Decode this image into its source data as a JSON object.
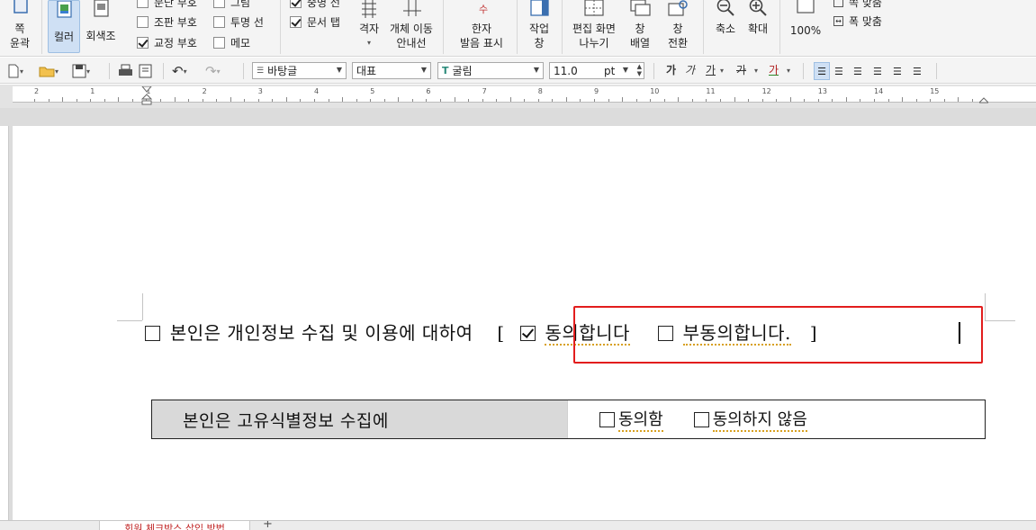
{
  "ribbon": {
    "outline_button": {
      "line1": "쪽",
      "line2": "윤곽"
    },
    "color_button": "컬러",
    "grayscale_button": "회색조",
    "checks_col1": [
      {
        "label": "문단 부호",
        "checked": false
      },
      {
        "label": "조판 부호",
        "checked": false
      },
      {
        "label": "교정 부호",
        "checked": true
      }
    ],
    "checks_col2": [
      {
        "label": "그림",
        "checked": false
      },
      {
        "label": "투명 선",
        "checked": false
      },
      {
        "label": "메모",
        "checked": false
      }
    ],
    "checks_col3": [
      {
        "label": "중명 선",
        "checked": true
      },
      {
        "label": "문서 탭",
        "checked": true
      }
    ],
    "grid_button": "격자",
    "object_guide_button": {
      "line1": "개체 이동",
      "line2": "안내선"
    },
    "hanja_button": {
      "icon_char": "수",
      "line1": "한자",
      "line2": "발음 표시"
    },
    "task_pane_button": {
      "line1": "작업",
      "line2": "창"
    },
    "split_view_button": {
      "line1": "편집 화면",
      "line2": "나누기"
    },
    "arrange_button": {
      "line1": "창",
      "line2": "배열"
    },
    "switch_button": {
      "line1": "창",
      "line2": "전환"
    },
    "zoom_out_button": "축소",
    "zoom_in_button": "확대",
    "zoom_level": "100%",
    "fit_page_label": "쪽 맞춤",
    "fit_width_label": "폭 맞춤"
  },
  "toolbar": {
    "style_value": "바탕글",
    "lang_value": "대표",
    "font_value": "굴림",
    "size_value": "11.0",
    "size_unit": "pt",
    "bold": "가",
    "italic": "가",
    "underline": "가",
    "strike": "가",
    "fontcolor": "가"
  },
  "ruler": {
    "labels": [
      "2",
      "1",
      "1",
      "2",
      "3",
      "4",
      "5",
      "6",
      "7",
      "8",
      "9",
      "10",
      "11",
      "12",
      "13",
      "14",
      "15"
    ]
  },
  "document": {
    "consent_text": "본인은 개인정보 수집 및 이용에 대하여",
    "bracket_open": "[",
    "agree_label": "동의합니다",
    "disagree_label": "부동의합니다.",
    "bracket_close": "]",
    "agree_checked": true,
    "disagree_checked": false,
    "table_label": "본인은 고유식별정보 수집에",
    "table_agree": "동의함",
    "table_disagree": "동의하지 않음"
  },
  "tab": {
    "doc_tab_label": "회원 체크박스 삽입 방법"
  },
  "colors": {
    "highlight_frame": "#e21d1d",
    "ribbon_bg": "#f4f4f4",
    "selected_button": "#cfe0f4",
    "table_shade": "#d9d9d9"
  }
}
